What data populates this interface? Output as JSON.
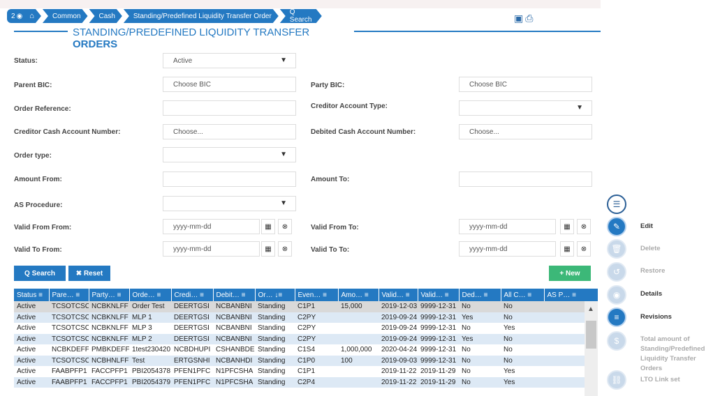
{
  "breadcrumb": {
    "badge": "2",
    "items": [
      "Common",
      "Cash",
      "Standing/Predefined Liquidity Transfer Order",
      "Q Search"
    ]
  },
  "page_title_line1": "STANDING/PREDEFINED LIQUIDITY TRANSFER",
  "page_title_line2": "ORDERS",
  "form": {
    "status_label": "Status:",
    "status_value": "Active",
    "parent_bic_label": "Parent BIC:",
    "parent_bic_placeholder": "Choose BIC",
    "party_bic_label": "Party BIC:",
    "party_bic_placeholder": "Choose BIC",
    "order_reference_label": "Order Reference:",
    "creditor_account_type_label": "Creditor Account Type:",
    "creditor_cash_account_label": "Creditor Cash Account Number:",
    "creditor_cash_account_placeholder": "Choose...",
    "debited_cash_account_label": "Debited Cash Account Number:",
    "debited_cash_account_placeholder": "Choose...",
    "order_type_label": "Order type:",
    "amount_from_label": "Amount From:",
    "amount_to_label": "Amount To:",
    "as_procedure_label": "AS Procedure:",
    "valid_from_from_label": "Valid From From:",
    "valid_from_from_placeholder": "yyyy-mm-dd",
    "valid_from_to_label": "Valid From To:",
    "valid_from_to_placeholder": "yyyy-mm-dd",
    "valid_to_from_label": "Valid To From:",
    "valid_to_from_placeholder": "yyyy-mm-dd",
    "valid_to_to_label": "Valid To To:",
    "valid_to_to_placeholder": "yyyy-mm-dd"
  },
  "buttons": {
    "search": "Q Search",
    "reset": "✖ Reset",
    "new": "+ New"
  },
  "table": {
    "headers": [
      "Status ≡",
      "Pare… ≡",
      "Party… ≡",
      "Orde… ≡",
      "Credi… ≡",
      "Debit… ≡",
      "Or… ↓≡",
      "Even… ≡",
      "Amo… ≡",
      "Valid… ≡",
      "Valid… ≡",
      "Ded… ≡",
      "All C… ≡",
      "AS P… ≡"
    ],
    "rows": [
      [
        "Active",
        "TCSOTCSC",
        "NCBKNLFF",
        "Order Test",
        "DEERTGSI",
        "NCBANBNI",
        "Standing",
        "C1P1",
        "15,000",
        "2019-12-03",
        "9999-12-31",
        "No",
        "No",
        ""
      ],
      [
        "Active",
        "TCSOTCSC",
        "NCBKNLFF",
        "MLP 1",
        "DEERTGSI",
        "NCBANBNI",
        "Standing",
        "C2PY",
        "",
        "2019-09-24",
        "9999-12-31",
        "Yes",
        "No",
        ""
      ],
      [
        "Active",
        "TCSOTCSC",
        "NCBKNLFF",
        "MLP 3",
        "DEERTGSI",
        "NCBANBNI",
        "Standing",
        "C2PY",
        "",
        "2019-09-24",
        "9999-12-31",
        "No",
        "Yes",
        ""
      ],
      [
        "Active",
        "TCSOTCSC",
        "NCBKNLFF",
        "MLP 2",
        "DEERTGSI",
        "NCBANBNI",
        "Standing",
        "C2PY",
        "",
        "2019-09-24",
        "9999-12-31",
        "Yes",
        "No",
        ""
      ],
      [
        "Active",
        "NCBKDEFF",
        "PMBKDEFF",
        "1test230420",
        "NCBDHUPI",
        "CSHANBDE",
        "Standing",
        "C1S4",
        "1,000,000",
        "2020-04-24",
        "9999-12-31",
        "No",
        "No",
        ""
      ],
      [
        "Active",
        "TCSOTCSC",
        "NCBHNLFF",
        "Test",
        "ERTGSNHI",
        "NCBANHDI",
        "Standing",
        "C1P0",
        "100",
        "2019-09-03",
        "9999-12-31",
        "No",
        "No",
        ""
      ],
      [
        "Active",
        "FAABPFP1",
        "FACCPFP1",
        "PBI2054378",
        "PFEN1PFC",
        "N1PFCSHA",
        "Standing",
        "C1P1",
        "",
        "2019-11-22",
        "2019-11-29",
        "No",
        "Yes",
        ""
      ],
      [
        "Active",
        "FAABPFP1",
        "FACCPFP1",
        "PBI2054379",
        "PFEN1PFC",
        "N1PFCSHA",
        "Standing",
        "C2P4",
        "",
        "2019-11-22",
        "2019-11-29",
        "No",
        "Yes",
        ""
      ]
    ]
  },
  "side_actions": {
    "edit": "Edit",
    "delete": "Delete",
    "restore": "Restore",
    "details": "Details",
    "revisions": "Revisions",
    "total_amount": "Total amount of Standing/Predefined Liquidity Transfer Orders",
    "lto_link_set": "LTO Link set"
  }
}
